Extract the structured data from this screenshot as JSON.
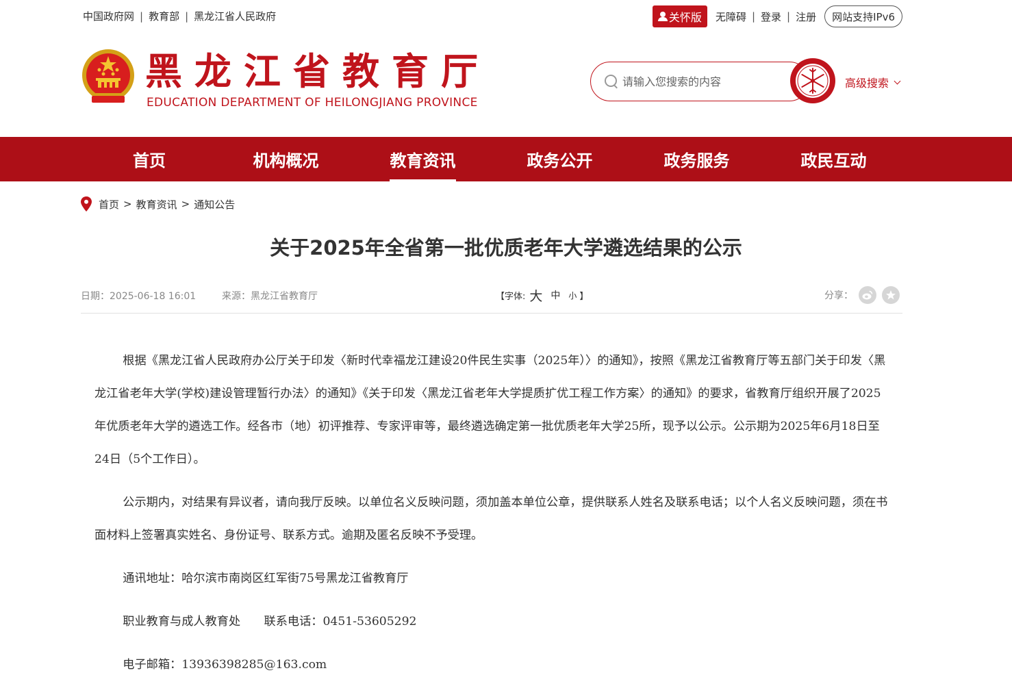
{
  "top": {
    "links": [
      "中国政府网",
      "教育部",
      "黑龙江省人民政府"
    ],
    "care_label": "关怀版",
    "accessibility": "无障碍",
    "login": "登录",
    "register": "注册",
    "ipv6": "网站支持IPv6"
  },
  "header": {
    "title": "黑龙江省教育厅",
    "subtitle": "EDUCATION DEPARTMENT OF HEILONGJIANG PROVINCE",
    "search_placeholder": "请输入您搜索的内容",
    "advanced_search": "高级搜索"
  },
  "nav": {
    "items": [
      "首页",
      "机构概况",
      "教育资讯",
      "政务公开",
      "政务服务",
      "政民互动"
    ],
    "active_index": 2
  },
  "breadcrumb": [
    "首页",
    "教育资讯",
    "通知公告"
  ],
  "article": {
    "title": "关于2025年全省第一批优质老年大学遴选结果的公示",
    "date": "日期：2025-06-18 16:01",
    "source": "来源：黑龙江省教育厅",
    "font_size": {
      "open": "【字体:",
      "large": "大",
      "medium": "中",
      "small": "小",
      "close": "】"
    },
    "share_label": "分享：",
    "paragraphs": [
      "根据《黑龙江省人民政府办公厅关于印发〈新时代幸福龙江建设20件民生实事（2025年）〉的通知》，按照《黑龙江省教育厅等五部门关于印发〈黑龙江省老年大学(学校)建设管理暂行办法〉的通知》《关于印发〈黑龙江省老年大学提质扩优工程工作方案〉的通知》的要求，省教育厅组织开展了2025年优质老年大学的遴选工作。经各市（地）初评推荐、专家评审等，最终遴选确定第一批优质老年大学25所，现予以公示。公示期为2025年6月18日至24日（5个工作日）。",
      "公示期内，对结果有异议者，请向我厅反映。以单位名义反映问题，须加盖本单位公章，提供联系人姓名及联系电话；以个人名义反映问题，须在书面材料上签署真实姓名、身份证号、联系方式。逾期及匿名反映不予受理。",
      "通讯地址：哈尔滨市南岗区红军街75号黑龙江省教育厅",
      "职业教育与成人教育处　　联系电话：0451-53605292",
      "电子邮箱：13936398285@163.com"
    ]
  },
  "colors": {
    "brand_red": "#c0141c",
    "nav_red": "#ad0f17"
  }
}
